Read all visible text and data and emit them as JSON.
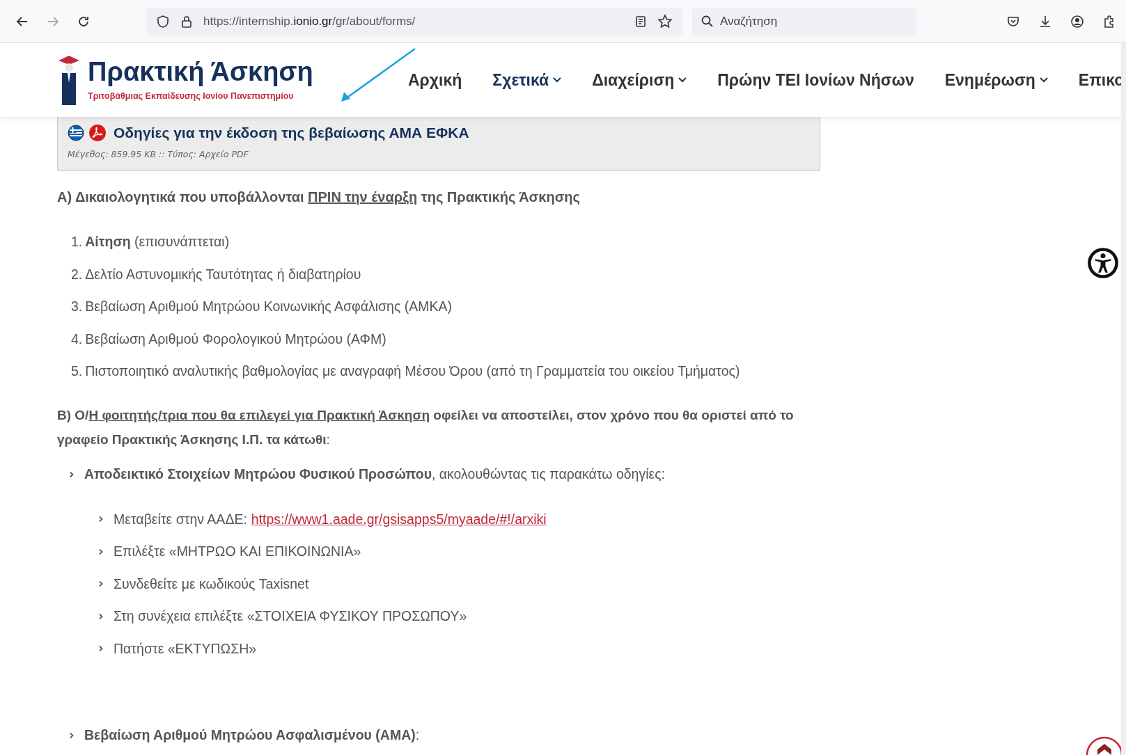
{
  "browser": {
    "url_prefix": "https://internship.",
    "url_domain": "ionio.gr",
    "url_path": "/gr/about/forms/",
    "search_placeholder": "Αναζήτηση"
  },
  "site": {
    "title": "Πρακτική Άσκηση",
    "subtitle": "Τριτοβάθμιας Εκπαίδευσης Ιονίου Πανεπιστημίου",
    "nav": [
      {
        "label": "Αρχική",
        "dropdown": false,
        "selected": false
      },
      {
        "label": "Σχετικά",
        "dropdown": true,
        "selected": true
      },
      {
        "label": "Διαχείριση",
        "dropdown": true,
        "selected": false
      },
      {
        "label": "Πρώην ΤΕΙ Ιονίων Νήσων",
        "dropdown": false,
        "selected": false
      },
      {
        "label": "Ενημέρωση",
        "dropdown": true,
        "selected": false
      },
      {
        "label": "Επικο",
        "dropdown": false,
        "selected": false
      }
    ]
  },
  "file": {
    "title": "Οδηγίες για την έκδοση της βεβαίωσης ΑΜΑ ΕΦΚΑ",
    "meta": "Μέγεθος: 859.95 KB :: Τύπος: Αρχείο PDF"
  },
  "section_a": {
    "parts": [
      {
        "text": "Α) Δικαιολογητικά που υποβάλλονται ",
        "underlined": false,
        "bold": true
      },
      {
        "text": "ΠΡΙΝ την έναρξη",
        "underlined": true,
        "bold": true
      },
      {
        "text": " της Πρακτικής Άσκησης",
        "underlined": false,
        "bold": true
      }
    ],
    "items": [
      {
        "number": "1.",
        "text": "**Αίτηση** (επισυνάπτεται)"
      },
      {
        "number": "2.",
        "text": "Δελτίο Αστυνομικής Ταυτότητας ή διαβατηρίου"
      },
      {
        "number": "3.",
        "text": "Βεβαίωση Αριθμού Μητρώου Κοινωνικής Ασφάλισης (ΑΜΚΑ)"
      },
      {
        "number": "4.",
        "text": "Βεβαίωση Αριθμού Φορολογικού Μητρώου (ΑΦΜ)"
      },
      {
        "number": "5.",
        "text": "Πιστοποιητικό αναλυτικής βαθμολογίας με αναγραφή Μέσου Όρου (από τη Γραμματεία του οικείου Τμήματος)"
      }
    ]
  },
  "section_b": {
    "parts": [
      {
        "text": "Β) Ο/",
        "underlined": false,
        "bold": true
      },
      {
        "text": "Η φοιτητής/τρια που θα επιλεγεί για Πρακτική Άσκηση",
        "underlined": true,
        "bold": true
      },
      {
        "text": " οφείλει να αποστείλει, στον χρόνο που θα οριστεί από το γραφείο Πρακτικής Άσκησης Ι.Π. τα κάτωθι",
        "underlined": false,
        "bold": true
      },
      {
        "text": ":",
        "underlined": false,
        "bold": false
      }
    ],
    "items": [
      {
        "text": "**Αποδεικτικό Στοιχείων Μητρώου Φυσικού Προσώπου**, ακολουθώντας τις παρακάτω οδηγίες:",
        "steps": [
          {
            "text": "Μεταβείτε στην ΑΑΔΕ:",
            "link": "https://www1.aade.gr/gsisapps5/myaade/#!/arxiki"
          },
          {
            "text": "Επιλέξτε «ΜΗΤΡΩΟ ΚΑΙ ΕΠΙΚΟΙΝΩΝΙΑ»"
          },
          {
            "text": "Συνδεθείτε με κωδικούς Taxisnet"
          },
          {
            "text": "Στη συνέχεια επιλέξτε «ΣΤΟΙΧΕΙΑ ΦΥΣΙΚΟΥ ΠΡΟΣΩΠΟΥ»"
          },
          {
            "text": "Πατήστε «ΕΚΤΥΠΩΣΗ»"
          }
        ]
      },
      {
        "text": "**Βεβαίωση Αριθμού Μητρώου Ασφαλισμένου (ΑΜΑ)**:"
      }
    ]
  }
}
